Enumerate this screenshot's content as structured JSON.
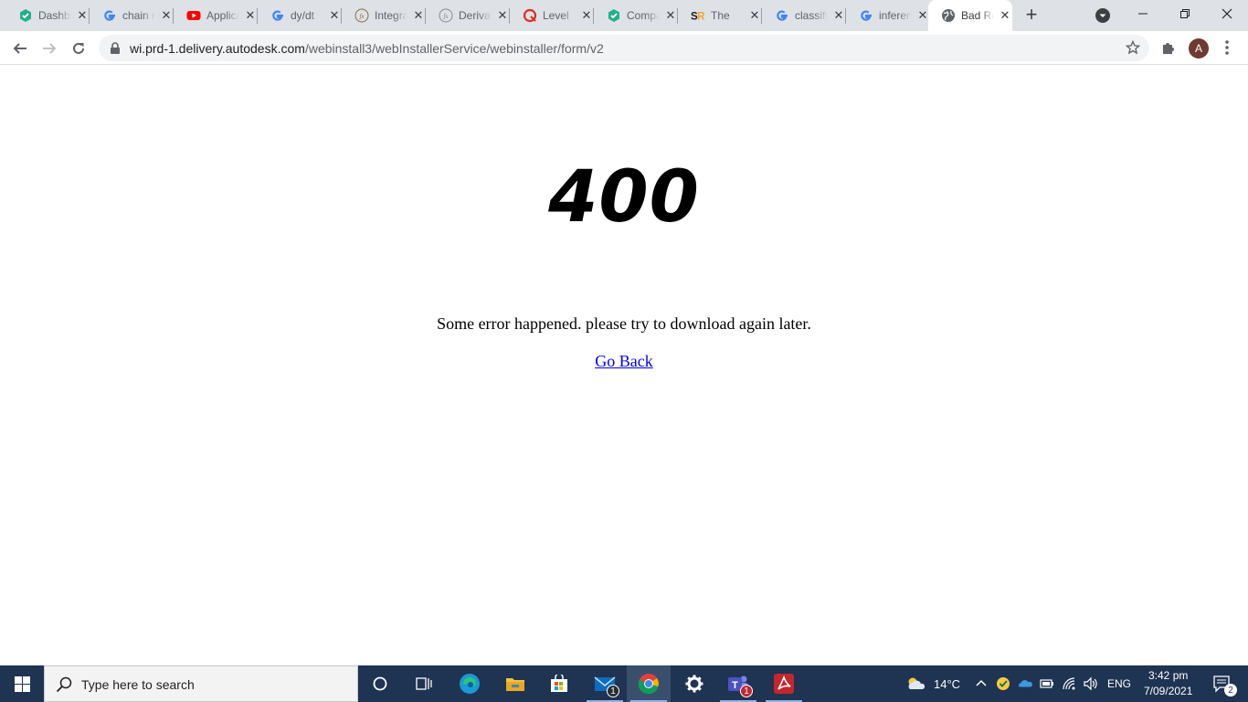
{
  "browser": {
    "tabs": [
      {
        "title": "Dashboard",
        "icon": "hex-check-icon",
        "color": "#1fb28a"
      },
      {
        "title": "chain rule",
        "icon": "google-icon",
        "color": "#4285f4"
      },
      {
        "title": "Applications",
        "icon": "youtube-icon",
        "color": "#ff0000"
      },
      {
        "title": "dy/dt",
        "icon": "google-icon",
        "color": "#4285f4"
      },
      {
        "title": "Integration",
        "icon": "fx-icon",
        "color": "#8a6d3b"
      },
      {
        "title": "Derivatives",
        "icon": "fx-icon",
        "color": "#8a8a8a"
      },
      {
        "title": "Level",
        "icon": "q-icon",
        "color": "#d93025"
      },
      {
        "title": "Compare",
        "icon": "hex-check-icon",
        "color": "#1fb28a"
      },
      {
        "title": "The",
        "icon": "sr-icon",
        "color": "#1a1a1a"
      },
      {
        "title": "classification",
        "icon": "google-icon",
        "color": "#4285f4"
      },
      {
        "title": "inference",
        "icon": "google-icon",
        "color": "#4285f4"
      },
      {
        "title": "Bad Request",
        "icon": "globe-icon",
        "color": "#5f6368",
        "active": true
      }
    ],
    "url_host": "wi.prd-1.delivery.autodesk.com",
    "url_path": "/webinstall3/webInstallerService/webinstaller/form/v2",
    "profile_initial": "A"
  },
  "page": {
    "error_code": "400",
    "message": "Some error happened. please try to download again later.",
    "go_back": "Go Back"
  },
  "taskbar": {
    "search_placeholder": "Type here to search",
    "mail_badge": "1",
    "teams_badge": "1",
    "weather": "14°C",
    "language": "ENG",
    "time": "3:42 pm",
    "date": "7/09/2021",
    "notifications": "2"
  }
}
